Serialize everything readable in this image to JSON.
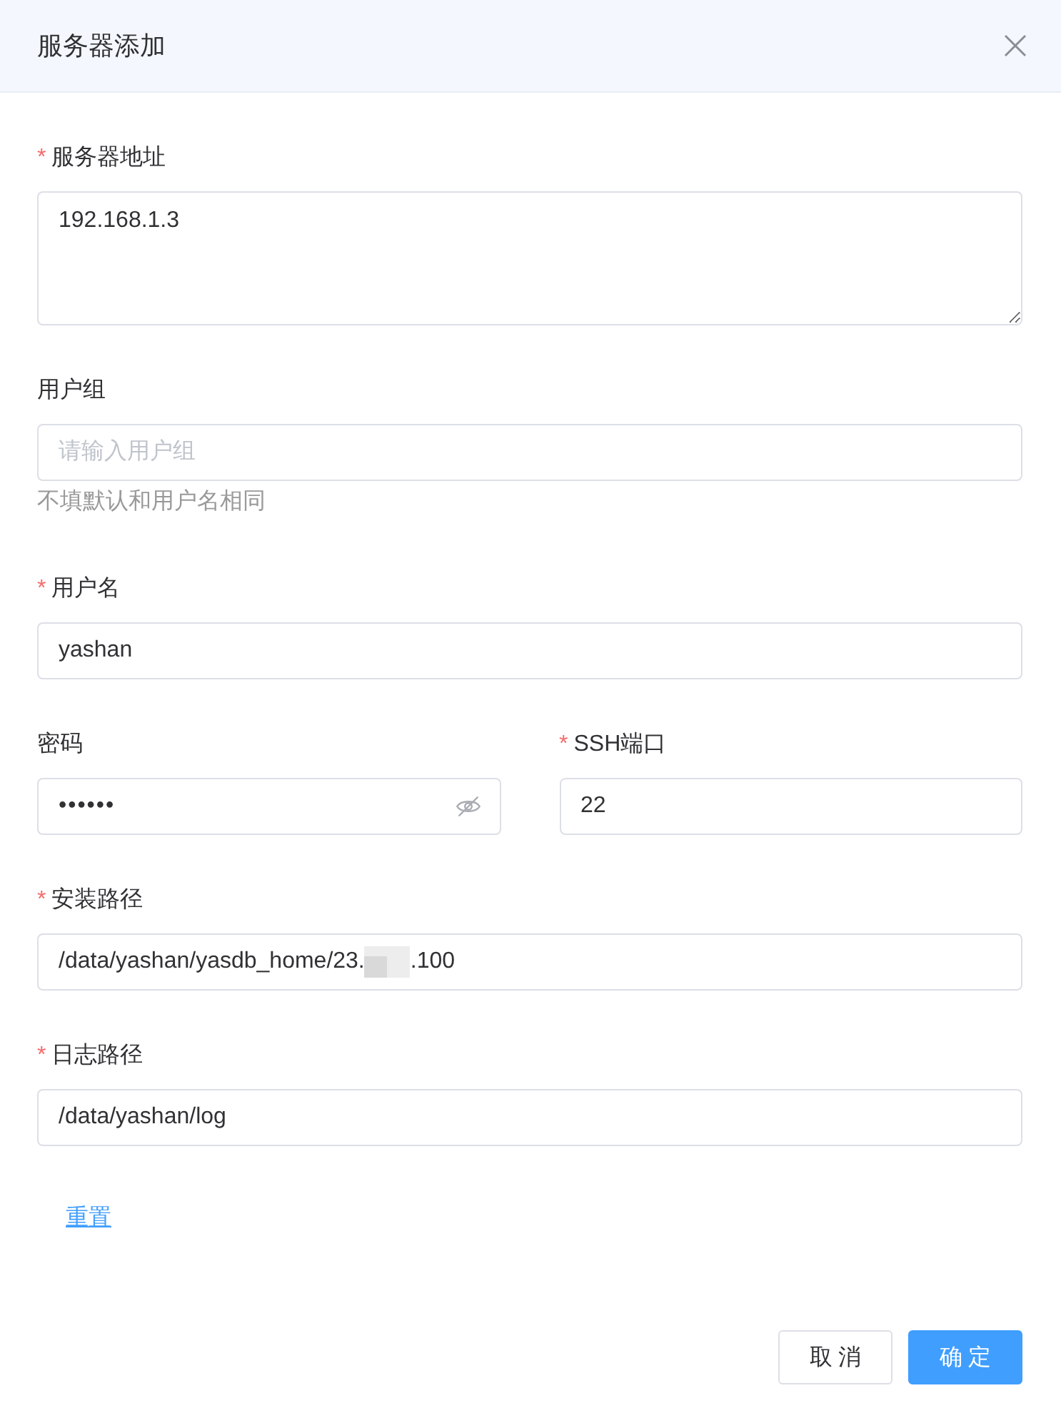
{
  "dialog": {
    "title": "服务器添加"
  },
  "form": {
    "required_mark": "*",
    "fields": [
      {
        "kind": "textarea",
        "label": "服务器地址",
        "required": true,
        "value": "192.168.1.3"
      },
      {
        "kind": "text",
        "label": "用户组",
        "required": false,
        "placeholder": "请输入用户组",
        "hint": "不填默认和用户名相同"
      },
      {
        "kind": "text",
        "label": "用户名",
        "required": true,
        "value": "yashan"
      },
      {
        "kind": "pair",
        "fields": [
          {
            "kind": "password",
            "label": "密码",
            "required": false,
            "value": "••••••",
            "visible": false
          },
          {
            "kind": "text",
            "label": "SSH端口",
            "required": true,
            "value": "22"
          }
        ]
      },
      {
        "kind": "text",
        "label": "安装路径",
        "required": true,
        "value": "/data/yashan/yasdb_home/23.",
        "redacted": true,
        "value_after": ".100"
      },
      {
        "kind": "text",
        "label": "日志路径",
        "required": true,
        "value": "/data/yashan/log"
      }
    ]
  },
  "reset_link": "重置",
  "buttons": [
    {
      "label": "取消",
      "kind": "default"
    },
    {
      "label": "确定",
      "kind": "primary"
    }
  ]
}
